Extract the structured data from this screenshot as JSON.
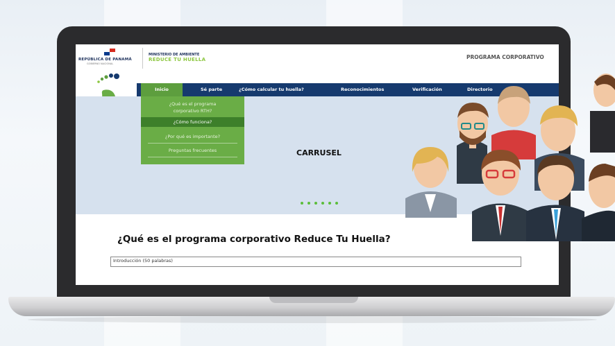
{
  "header": {
    "country": "REPÚBLICA DE PANAMÁ",
    "government": "GOBIERNO NACIONAL",
    "ministry": "MINISTERIO DE AMBIENTE",
    "program_brand": "REDUCE TU HUELLA",
    "section": "PROGRAMA CORPORATIVO"
  },
  "nav": {
    "items": [
      {
        "label": "Inicio",
        "active": true
      },
      {
        "label": "Sé parte"
      },
      {
        "label": "¿Cómo calcular tu huella?"
      },
      {
        "label": "Reconocimientos"
      },
      {
        "label": "Verificación"
      },
      {
        "label": "Directorio"
      }
    ]
  },
  "dropdown": {
    "items": [
      {
        "label": "¿Qué es el programa"
      },
      {
        "label": "corporativo RTH?"
      },
      {
        "label": "¿Cómo funciona?",
        "active": true
      },
      {
        "label": "¿Por qué es importante?"
      },
      {
        "label": "Preguntas frecuentes"
      }
    ]
  },
  "carousel": {
    "label": "CARRUSEL",
    "dot_count": 6
  },
  "main": {
    "headline": "¿Qué es el programa corporativo Reduce Tu Huella?",
    "intro_placeholder": "Introducción (50 palabras)"
  },
  "colors": {
    "nav_bg": "#163a6e",
    "accent_green": "#6aad46",
    "carousel_bg": "#d6e1ee"
  }
}
